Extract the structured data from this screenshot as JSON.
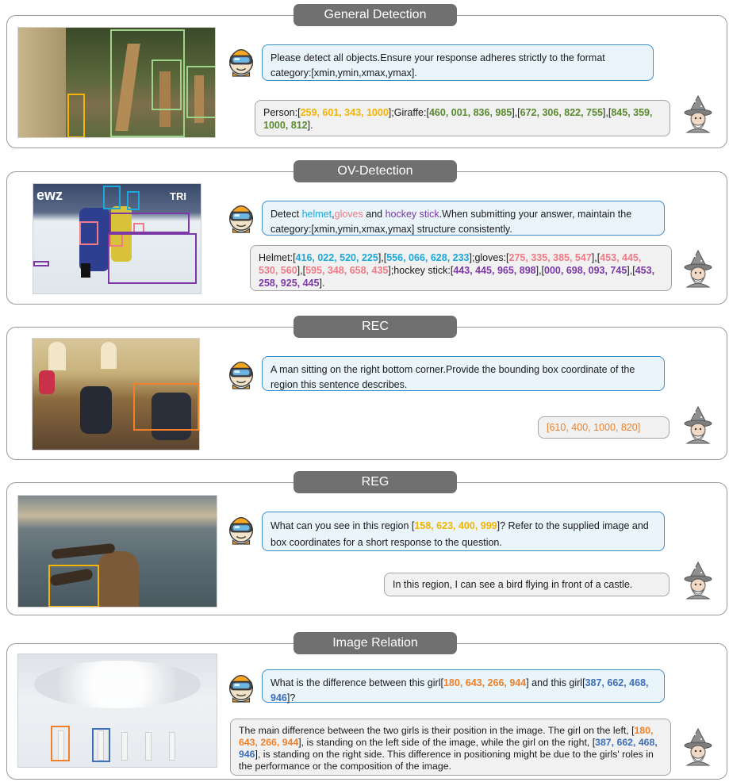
{
  "sections": {
    "general": {
      "title": "General Detection",
      "question": "Please detect all objects.Ensure your response adheres strictly to the format category:[xmin,ymin,xmax,ymax].",
      "answer": {
        "person_label": "Person:[",
        "person_box": "259, 601, 343, 1000",
        "giraffe_label": "];Giraffe:[",
        "giraffe_box1": "460, 001, 836, 985",
        "giraffe_box2": "672, 306, 822, 755",
        "giraffe_box3": "845, 359, 1000, 812",
        "sep": "],[",
        "end": "]."
      }
    },
    "ov": {
      "title": "OV-Detection",
      "question": {
        "prefix": "Detect ",
        "w1": "helmet",
        "sep1": ",",
        "w2": "gloves",
        "and": " and ",
        "w3": "hockey stick",
        "suffix": ".When submitting your answer, maintain the category:[xmin,ymin,xmax,ymax] structure consistently."
      },
      "answer": {
        "helmet_label": "Helmet:[",
        "helmet_box1": "416, 022, 520, 225",
        "helmet_box2": "556, 066, 628, 233",
        "gloves_label": "];gloves:[",
        "gloves_box1": "275, 335, 385, 547",
        "gloves_box2": "453, 445, 530, 560",
        "gloves_box3": "595, 348, 658, 435",
        "stick_label": "];hockey stick:[",
        "stick_box1": "443, 445, 965, 898",
        "stick_box2": "000, 698, 093, 745",
        "stick_box3": "453, 258, 925, 445",
        "sep": "],[",
        "end": "]."
      }
    },
    "rec": {
      "title": "REC",
      "question": "A man sitting on the right bottom corner.Provide the bounding box coordinate of the region this sentence describes.",
      "answer": {
        "open": "[",
        "box": "610, 400, 1000, 820",
        "close": "]"
      }
    },
    "reg": {
      "title": "REG",
      "question": {
        "prefix": "What can you see in this region [",
        "box": "158, 623, 400, 999",
        "suffix": "]? Refer to the supplied image and box coordinates for a short response to the question."
      },
      "answer": "In this region, I can see a bird flying in front of a castle."
    },
    "relation": {
      "title": "Image Relation",
      "question": {
        "p1": "What is the difference between this girl[",
        "box1": "180, 643, 266, 944",
        "p2": "] and this girl[",
        "box2": "387, 662, 468, 946",
        "p3": "]?"
      },
      "answer": {
        "a1": "The main difference between the two girls is their position in the image. The girl on the left, [",
        "box1": "180, 643, 266, 944",
        "a2": "], is standing on the left side of the image, while the girl on the right, [",
        "box2": "387, 662, 468, 946",
        "a3": "], is standing on the right side. This difference in positioning might be due to the girls' roles in the performance or the composition of the image."
      }
    }
  },
  "colors": {
    "yellow": "#f5b400",
    "green": "#5a8a2f",
    "blue": "#1ba8dc",
    "pink": "#f07a86",
    "purple": "#7d38a8",
    "orange": "#f0812a",
    "steel": "#3f6fbb",
    "question_border": "#3e8ec7"
  },
  "icons": [
    "vr-robot-avatar-icon",
    "wizard-avatar-icon"
  ]
}
